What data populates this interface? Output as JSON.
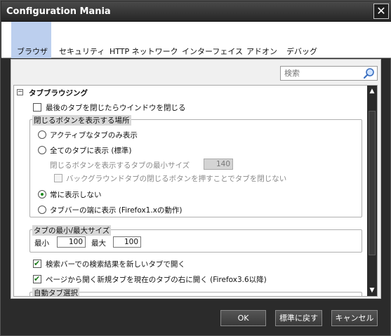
{
  "window": {
    "title": "Configuration Mania",
    "close_glyph": "✕"
  },
  "tabs": [
    {
      "label": "ブラウザ",
      "active": true
    },
    {
      "label": "セキュリティ"
    },
    {
      "label": "HTTP ネットワーク"
    },
    {
      "label": "インターフェイス"
    },
    {
      "label": "アドオン"
    },
    {
      "label": "デバッグ"
    }
  ],
  "search": {
    "placeholder": "検索",
    "icon": "search-icon"
  },
  "section": {
    "title": "タブブラウジング",
    "collapse_glyph": "−",
    "close_last_tab": {
      "label": "最後のタブを閉じたらウインドウを閉じる",
      "checked": false
    },
    "close_button_group": {
      "legend": "閉じるボタンを表示する場所",
      "opt_active_only": {
        "label": "アクティブなタブのみ表示",
        "checked": false
      },
      "opt_all_tabs": {
        "label": "全てのタブに表示 (標準)",
        "checked": false
      },
      "min_size_label": "閉じるボタンを表示するタブの最小サイズ",
      "min_size_value": "140",
      "bg_tab_close": {
        "label": "バックグラウンドタブの閉じるボタンを押すことでタブを閉じない",
        "checked": false
      },
      "opt_never": {
        "label": "常に表示しない",
        "checked": true
      },
      "opt_tabbar_end": {
        "label": "タブバーの端に表示 (Firefox1.xの動作)",
        "checked": false
      }
    },
    "tab_size_group": {
      "legend": "タブの最小/最大サイズ",
      "min_label": "最小",
      "min_value": "100",
      "max_label": "最大",
      "max_value": "100"
    },
    "search_new_tab": {
      "label": "検索バーでの検索結果を新しいタブで開く",
      "checked": true
    },
    "open_right": {
      "label": "ページから開く新規タブを現在のタブの右に開く (Firefox3.6以降)",
      "checked": true
    },
    "auto_select_legend": "自動タブ選択"
  },
  "buttons": {
    "ok": "OK",
    "reset": "標準に戻す",
    "cancel": "キャンセル"
  },
  "colors": {
    "active_tab": "#bccfee",
    "title_bar": "#2b2b2b",
    "check_green": "#1a8a1a"
  }
}
